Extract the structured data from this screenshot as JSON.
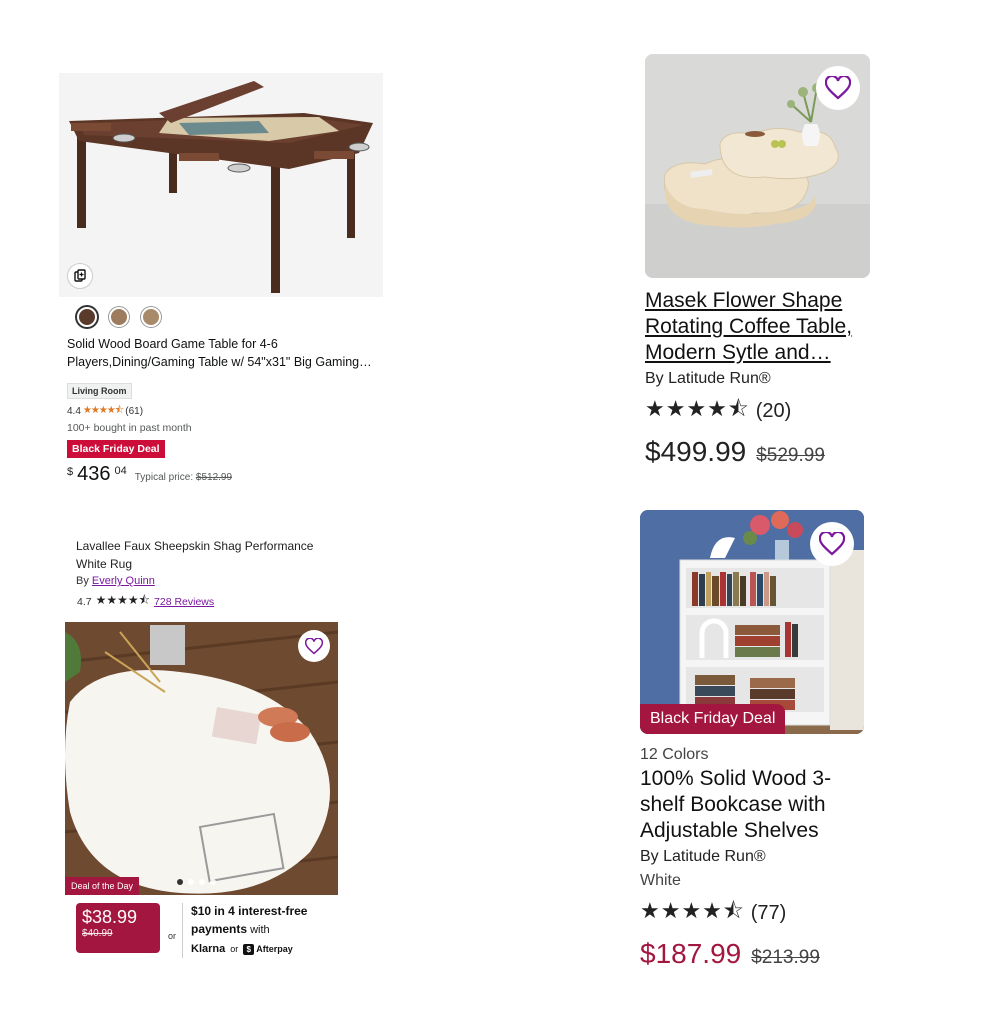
{
  "card1": {
    "title": "Solid Wood Board Game Table for 4-6 Players,Dining/Gaming Table w/ 54\"x31\" Big Gaming…",
    "tag": "Living Room",
    "rating_value": "4.4",
    "stars": "★★★★⯪",
    "review_count": "(61)",
    "bought": "100+ bought in past month",
    "deal_badge": "Black Friday Deal",
    "price_currency": "$",
    "price_whole": "436",
    "price_fraction": "04",
    "typical_label": "Typical price:",
    "typical_price": "$512.99",
    "swatch_colors": [
      "#5a3a2a",
      "#9c7b5e",
      "#a88a6a"
    ]
  },
  "card2": {
    "title": "Masek Flower Shape Rotating Coffee Table, Modern Sytle and…",
    "brand": "By Latitude Run®",
    "stars": "★★★★⯪",
    "review_count": "(20)",
    "price": "$499.99",
    "was_price": "$529.99"
  },
  "card3": {
    "title": "Lavallee Faux Sheepskin Shag Performance White Rug",
    "brand_prefix": "By",
    "brand": "Everly Quinn",
    "rating_value": "4.7",
    "stars": "★★★★⯪",
    "reviews_link": "728 Reviews",
    "deal_badge": "Deal of the Day",
    "price": "$38.99",
    "was_price": "$40.99",
    "or_text": "or",
    "bnpl_amount": "$10",
    "bnpl_text_1": "in 4 interest-free",
    "bnpl_text_2": "payments",
    "bnpl_text_3": "with",
    "klarna": "Klarna",
    "or_text_2": "or",
    "afterpay": "Afterpay",
    "afterpay_icon": "$"
  },
  "card4": {
    "deal_badge": "Black Friday Deal",
    "colors": "12 Colors",
    "title": "100% Solid Wood 3-shelf Bookcase with Adjustable Shelves",
    "brand": "By Latitude Run®",
    "variant": "White",
    "stars": "★★★★⯪",
    "review_count": "(77)",
    "price": "$187.99",
    "was_price": "$213.99",
    "accent_color": "#a3163f"
  },
  "accent": {
    "wayfair_purple": "#7b189f",
    "wayfair_deal": "#a3163f",
    "amazon_deal": "#cc0c39",
    "amazon_star": "#de7921"
  },
  "icons": [
    "add-to-cart-icon",
    "heart-icon"
  ]
}
